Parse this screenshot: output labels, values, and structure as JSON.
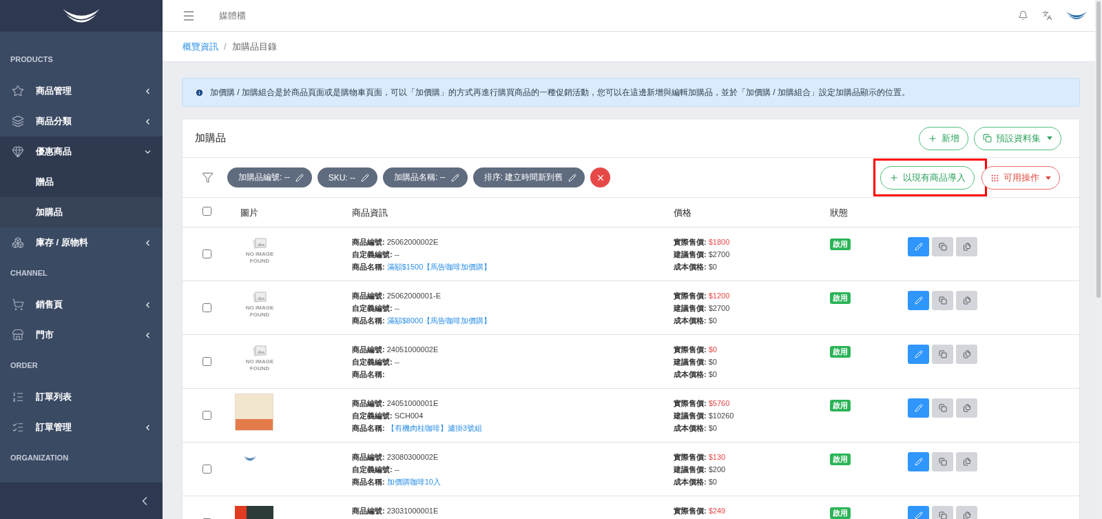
{
  "topbar": {
    "title": "媒體櫃"
  },
  "breadcrumb_separator": "/",
  "breadcrumb": [
    {
      "label": "概覽資訊",
      "link": true
    },
    {
      "label": "加購品目錄",
      "link": false
    }
  ],
  "sidebar": {
    "sections": [
      {
        "heading": "PRODUCTS",
        "items": [
          {
            "label": "商品管理",
            "expanded": false,
            "selected": false
          },
          {
            "label": "商品分類",
            "expanded": false,
            "selected": false
          },
          {
            "label": "優惠商品",
            "expanded": true,
            "selected": false,
            "children": [
              {
                "label": "贈品",
                "selected": false
              },
              {
                "label": "加購品",
                "selected": true
              }
            ]
          },
          {
            "label": "庫存 / 原物料",
            "expanded": false,
            "selected": false
          }
        ]
      },
      {
        "heading": "CHANNEL",
        "items": [
          {
            "label": "銷售頁",
            "expanded": false,
            "selected": false
          },
          {
            "label": "門市",
            "expanded": false,
            "selected": false
          }
        ]
      },
      {
        "heading": "ORDER",
        "items": [
          {
            "label": "訂單列表",
            "selected": false
          },
          {
            "label": "訂單管理",
            "expanded": false,
            "selected": false
          }
        ]
      },
      {
        "heading": "ORGANIZATION"
      }
    ]
  },
  "alert": "加價購 / 加購組合是於商品頁面或是購物車頁面，可以「加價購」的方式再進行購買商品的一種促銷活動，您可以在這邊新增與編輯加購品，並於「加價購 / 加購組合」設定加購品顯示的位置。",
  "card": {
    "title": "加購品",
    "header_buttons": [
      {
        "label": "新增",
        "dropdown": false
      },
      {
        "label": "預設資料集",
        "dropdown": true
      }
    ]
  },
  "filters": [
    {
      "label": "加購品編號: --"
    },
    {
      "label": "SKU: --"
    },
    {
      "label": "加購品名稱: --"
    },
    {
      "label": "排序: 建立時間新到舊"
    }
  ],
  "filter_actions": [
    {
      "label": "以現有商品導入",
      "kind": "import",
      "highlighted": true
    },
    {
      "label": "可用操作",
      "kind": "actions",
      "highlighted": false
    }
  ],
  "table": {
    "columns": [
      "圖片",
      "商品資訊",
      "價格",
      "狀態"
    ],
    "all_checked": false,
    "rows": [
      {
        "checked": false,
        "kind": "no-image",
        "image_text": "NO IMAGE FOUND",
        "info": [
          {
            "label": "商品編號:",
            "value": "25062000002E"
          },
          {
            "label": "自定義編號:",
            "value": "--"
          },
          {
            "label": "商品名稱:",
            "value": "滿額$1500【馬告咖啡加價購】",
            "link": true
          }
        ],
        "prices": [
          {
            "label": "實際售價:",
            "value": "$1800",
            "highlight": true
          },
          {
            "label": "建議售價:",
            "value": "$2700"
          },
          {
            "label": "成本價格:",
            "value": "$0"
          }
        ],
        "status": "啟用"
      },
      {
        "checked": false,
        "kind": "no-image",
        "image_text": "NO IMAGE FOUND",
        "info": [
          {
            "label": "商品編號:",
            "value": "25062000001-E"
          },
          {
            "label": "自定義編號:",
            "value": "--"
          },
          {
            "label": "商品名稱:",
            "value": "滿額$8000【馬告咖啡加價購】",
            "link": true
          }
        ],
        "prices": [
          {
            "label": "實際售價:",
            "value": "$1200",
            "highlight": true
          },
          {
            "label": "建議售價:",
            "value": "$2700"
          },
          {
            "label": "成本價格:",
            "value": "$0"
          }
        ],
        "status": "啟用"
      },
      {
        "checked": false,
        "kind": "no-image",
        "image_text": "NO IMAGE FOUND",
        "info": [
          {
            "label": "商品編號:",
            "value": "24051000002E"
          },
          {
            "label": "自定義編號:",
            "value": "--"
          },
          {
            "label": "商品名稱:"
          }
        ],
        "prices": [
          {
            "label": "實際售價:",
            "value": "$0",
            "highlight": true
          },
          {
            "label": "建議售價:",
            "value": "$0"
          },
          {
            "label": "成本價格:",
            "value": "$0"
          }
        ],
        "status": "啟用"
      },
      {
        "checked": false,
        "kind": "photo",
        "info": [
          {
            "label": "商品編號:",
            "value": "24051000001E"
          },
          {
            "label": "自定義編號:",
            "value": "SCH004"
          },
          {
            "label": "商品名稱:",
            "value": "【有機肉桂咖啡】濾掛3號組",
            "link": true
          }
        ],
        "prices": [
          {
            "label": "實際售價:",
            "value": "$5760",
            "highlight": true
          },
          {
            "label": "建議售價:",
            "value": "$10260"
          },
          {
            "label": "成本價格:",
            "value": "$0"
          }
        ],
        "status": "啟用"
      },
      {
        "checked": false,
        "kind": "logo",
        "info": [
          {
            "label": "商品編號:",
            "value": "23080300002E"
          },
          {
            "label": "自定義編號:",
            "value": "--"
          },
          {
            "label": "商品名稱:",
            "value": "加價購咖啡10入",
            "link": true
          }
        ],
        "prices": [
          {
            "label": "實際售價:",
            "value": "$130",
            "highlight": true
          },
          {
            "label": "建議售價:",
            "value": "$200"
          },
          {
            "label": "成本價格:",
            "value": "$0"
          }
        ],
        "status": "啟用"
      },
      {
        "checked": false,
        "kind": "red-photo",
        "info": [
          {
            "label": "商品編號:",
            "value": "23031000001E"
          }
        ],
        "prices": [
          {
            "label": "實際售價:",
            "value": "$249",
            "highlight": true
          }
        ],
        "status": "啟用"
      }
    ]
  }
}
